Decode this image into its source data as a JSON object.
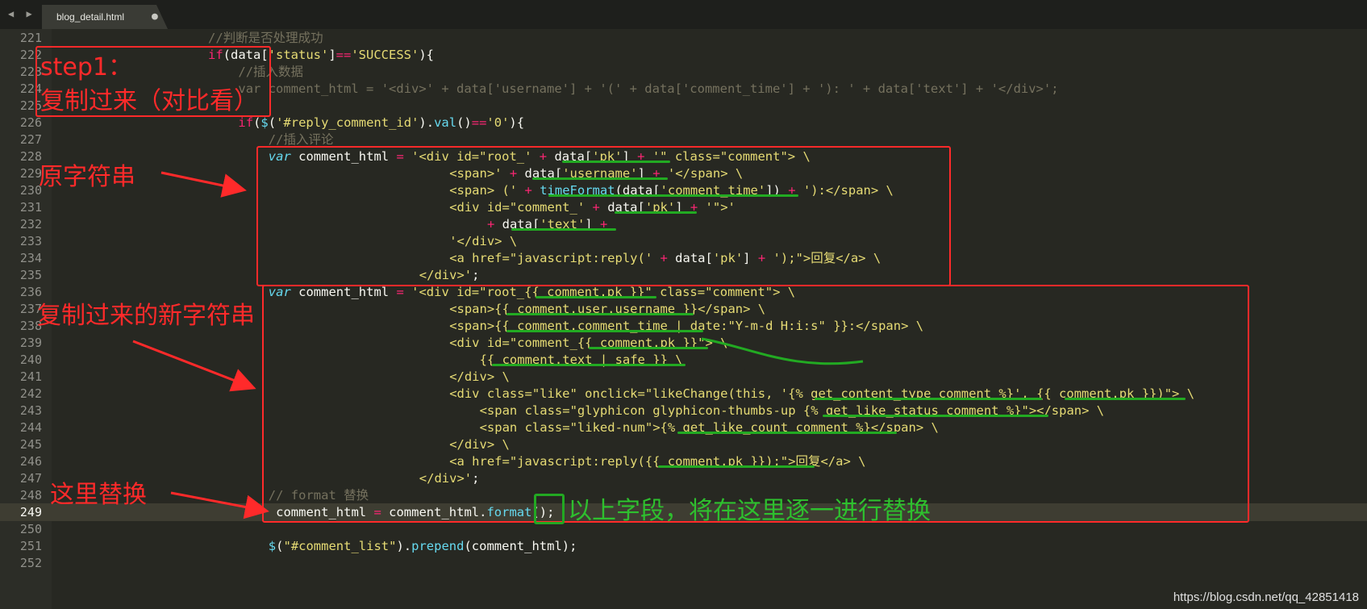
{
  "tab": {
    "title": "blog_detail.html",
    "modified_dot": "●",
    "nav": "◀ ▶"
  },
  "editor": {
    "lines": [
      {
        "n": "221",
        "indent": 24,
        "segs": [
          [
            "c-cm",
            "//判断是否处理成功"
          ]
        ]
      },
      {
        "n": "222",
        "indent": 24,
        "segs": [
          [
            "c-kw",
            "if"
          ],
          [
            "",
            "(data["
          ],
          [
            "c-str",
            "'status'"
          ],
          [
            "",
            "]"
          ],
          [
            "c-kw",
            "=="
          ],
          [
            "c-str",
            "'SUCCESS'"
          ],
          [
            "",
            "){"
          ]
        ]
      },
      {
        "n": "223",
        "indent": 28,
        "segs": [
          [
            "c-cm",
            "//插入数据"
          ]
        ]
      },
      {
        "n": "224",
        "indent": 28,
        "segs": [
          [
            "c-cm",
            "var comment_html = '<div>' + data['username'] + '(' + data['comment_time'] + '): ' + data['text'] + '</div>';"
          ]
        ]
      },
      {
        "n": "225",
        "indent": 28,
        "segs": []
      },
      {
        "n": "226",
        "indent": 28,
        "segs": [
          [
            "c-kw",
            "if"
          ],
          [
            "",
            "("
          ],
          [
            "c-fn",
            "$"
          ],
          [
            "",
            "("
          ],
          [
            "c-str",
            "'#reply_comment_id'"
          ],
          [
            "",
            ")."
          ],
          [
            "c-fn",
            "val"
          ],
          [
            "",
            "()"
          ],
          [
            "c-kw",
            "=="
          ],
          [
            "c-str",
            "'0'"
          ],
          [
            "",
            "){"
          ]
        ]
      },
      {
        "n": "227",
        "indent": 32,
        "segs": [
          [
            "c-cm",
            "//插入评论"
          ]
        ]
      },
      {
        "n": "228",
        "indent": 32,
        "segs": [
          [
            "c-var",
            "var"
          ],
          [
            "",
            " comment_html "
          ],
          [
            "c-kw",
            "="
          ],
          [
            "",
            " "
          ],
          [
            "c-str",
            "'<div id=\"root_'"
          ],
          [
            "",
            " "
          ],
          [
            "c-kw",
            "+"
          ],
          [
            "",
            " data["
          ],
          [
            "c-str",
            "'pk'"
          ],
          [
            "",
            "] "
          ],
          [
            "c-kw",
            "+"
          ],
          [
            "",
            " "
          ],
          [
            "c-str",
            "'\" class=\"comment\"> \\"
          ]
        ]
      },
      {
        "n": "229",
        "indent": 56,
        "segs": [
          [
            "c-str",
            "<span>'"
          ],
          [
            "",
            " "
          ],
          [
            "c-kw",
            "+"
          ],
          [
            "",
            " data["
          ],
          [
            "c-str",
            "'username'"
          ],
          [
            "",
            "] "
          ],
          [
            "c-kw",
            "+"
          ],
          [
            "",
            " "
          ],
          [
            "c-str",
            "'</span> \\"
          ]
        ]
      },
      {
        "n": "230",
        "indent": 56,
        "segs": [
          [
            "c-str",
            "<span> ('"
          ],
          [
            "",
            " "
          ],
          [
            "c-kw",
            "+"
          ],
          [
            "",
            " "
          ],
          [
            "c-fn",
            "timeFormat"
          ],
          [
            "",
            "(data["
          ],
          [
            "c-str",
            "'comment_time'"
          ],
          [
            "",
            "]) "
          ],
          [
            "c-kw",
            "+"
          ],
          [
            "",
            " "
          ],
          [
            "c-str",
            "'):</span> \\"
          ]
        ]
      },
      {
        "n": "231",
        "indent": 56,
        "segs": [
          [
            "c-str",
            "<div id=\"comment_'"
          ],
          [
            "",
            " "
          ],
          [
            "c-kw",
            "+"
          ],
          [
            "",
            " data["
          ],
          [
            "c-str",
            "'pk'"
          ],
          [
            "",
            "] "
          ],
          [
            "c-kw",
            "+"
          ],
          [
            "",
            " "
          ],
          [
            "c-str",
            "'\">'"
          ]
        ]
      },
      {
        "n": "232",
        "indent": 61,
        "segs": [
          [
            "c-kw",
            "+"
          ],
          [
            "",
            " data["
          ],
          [
            "c-str",
            "'text'"
          ],
          [
            "",
            "] "
          ],
          [
            "c-kw",
            "+"
          ]
        ]
      },
      {
        "n": "233",
        "indent": 56,
        "segs": [
          [
            "c-str",
            "'</div> \\"
          ]
        ]
      },
      {
        "n": "234",
        "indent": 56,
        "segs": [
          [
            "c-str",
            "<a href=\"javascript:reply('"
          ],
          [
            "",
            " "
          ],
          [
            "c-kw",
            "+"
          ],
          [
            "",
            " data["
          ],
          [
            "c-str",
            "'pk'"
          ],
          [
            "",
            "] "
          ],
          [
            "c-kw",
            "+"
          ],
          [
            "",
            " "
          ],
          [
            "c-str",
            "');\">回复</a> \\"
          ]
        ]
      },
      {
        "n": "235",
        "indent": 52,
        "segs": [
          [
            "c-str",
            "</div>'"
          ],
          [
            "",
            ";"
          ]
        ]
      },
      {
        "n": "236",
        "indent": 32,
        "segs": [
          [
            "c-var",
            "var"
          ],
          [
            "",
            " comment_html "
          ],
          [
            "c-kw",
            "="
          ],
          [
            "",
            " "
          ],
          [
            "c-str",
            "'<div id=\"root_{{ comment.pk }}\" class=\"comment\"> \\"
          ]
        ]
      },
      {
        "n": "237",
        "indent": 56,
        "segs": [
          [
            "c-str",
            "<span>{{ comment.user.username }}</span> \\"
          ]
        ]
      },
      {
        "n": "238",
        "indent": 56,
        "segs": [
          [
            "c-str",
            "<span>{{ comment.comment_time | date:\"Y-m-d H:i:s\" }}:</span> \\"
          ]
        ]
      },
      {
        "n": "239",
        "indent": 56,
        "segs": [
          [
            "c-str",
            "<div id=\"comment_{{ comment.pk }}\"> \\"
          ]
        ]
      },
      {
        "n": "240",
        "indent": 60,
        "segs": [
          [
            "c-str",
            "{{ comment.text | safe }} \\"
          ]
        ]
      },
      {
        "n": "241",
        "indent": 56,
        "segs": [
          [
            "c-str",
            "</div> \\"
          ]
        ]
      },
      {
        "n": "242",
        "indent": 56,
        "segs": [
          [
            "c-str",
            "<div class=\"like\" onclick=\"likeChange(this, '{% get_content_type comment %}', {{ comment.pk }})\"> \\"
          ]
        ]
      },
      {
        "n": "243",
        "indent": 60,
        "segs": [
          [
            "c-str",
            "<span class=\"glyphicon glyphicon-thumbs-up {% get_like_status comment %}\"></span> \\"
          ]
        ]
      },
      {
        "n": "244",
        "indent": 60,
        "segs": [
          [
            "c-str",
            "<span class=\"liked-num\">{% get_like_count comment %}</span> \\"
          ]
        ]
      },
      {
        "n": "245",
        "indent": 56,
        "segs": [
          [
            "c-str",
            "</div> \\"
          ]
        ]
      },
      {
        "n": "246",
        "indent": 56,
        "segs": [
          [
            "c-str",
            "<a href=\"javascript:reply({{ comment.pk }});\">回复</a> \\"
          ]
        ]
      },
      {
        "n": "247",
        "indent": 52,
        "segs": [
          [
            "c-str",
            "</div>'"
          ],
          [
            "",
            ";"
          ]
        ]
      },
      {
        "n": "248",
        "indent": 32,
        "segs": [
          [
            "c-cm",
            "// format 替换"
          ]
        ]
      },
      {
        "n": "249",
        "indent": 32,
        "segs": [
          [
            "",
            " comment_html "
          ],
          [
            "c-kw",
            "="
          ],
          [
            "",
            " comment_html."
          ],
          [
            "c-fn",
            "format"
          ],
          [
            "",
            "();"
          ]
        ]
      },
      {
        "n": "250",
        "indent": 32,
        "segs": []
      },
      {
        "n": "251",
        "indent": 32,
        "segs": [
          [
            "c-fn",
            "$"
          ],
          [
            "",
            "("
          ],
          [
            "c-str",
            "\"#comment_list\""
          ],
          [
            "",
            ")."
          ],
          [
            "c-fn",
            "prepend"
          ],
          [
            "",
            "(comment_html);"
          ]
        ]
      },
      {
        "n": "252",
        "indent": 32,
        "segs": []
      }
    ]
  },
  "annotations": {
    "step1_line1": "step1：",
    "step1_line2": "复制过来（对比看）",
    "original": "原字符串",
    "copied": "复制过来的新字符串",
    "replace_here": "这里替换",
    "green_note": "以上字段，将在这里逐一进行替换"
  },
  "colors": {
    "annotation_red": "#ff2a2a",
    "annotation_green": "#22aa22",
    "editor_bg": "#272822"
  },
  "watermark": "https://blog.csdn.net/qq_42851418"
}
